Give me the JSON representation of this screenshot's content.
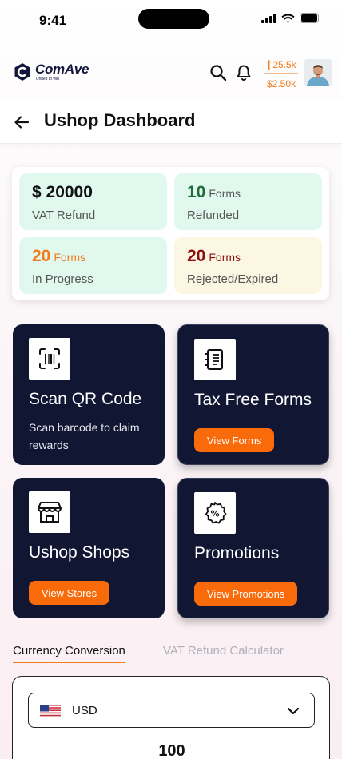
{
  "status_bar": {
    "time": "9:41"
  },
  "header": {
    "brand_name": "ComAve",
    "brand_tagline": "United to win",
    "wallet_points": "25.5k",
    "wallet_money": "$2.50k",
    "icons": [
      "search-icon",
      "bell-icon",
      "coin-icon"
    ]
  },
  "page": {
    "title": "Ushop Dashboard"
  },
  "stats": [
    {
      "value": "$ 20000",
      "unit": "",
      "label": "VAT Refund"
    },
    {
      "value": "10",
      "unit": "Forms",
      "label": "Refunded"
    },
    {
      "value": "20",
      "unit": "Forms",
      "label": "In Progress"
    },
    {
      "value": "20",
      "unit": "Forms",
      "label": "Rejected/Expired"
    }
  ],
  "actions": [
    {
      "title": "Scan QR Code",
      "description": "Scan barcode to claim rewards",
      "icon": "qr-scan-icon"
    },
    {
      "title": "Tax Free Forms",
      "button": "View Forms",
      "icon": "notebook-icon"
    },
    {
      "title": "Ushop Shops",
      "button": "View Stores",
      "icon": "store-icon"
    },
    {
      "title": "Promotions",
      "button": "View Promotions",
      "icon": "percent-badge-icon"
    }
  ],
  "tabs": {
    "active": "Currency Conversion",
    "inactive": "VAT Refund Calculator"
  },
  "conversion": {
    "currency": "USD",
    "amount": "100",
    "flag": "us-flag-icon"
  },
  "colors": {
    "accent": "#f96a0b",
    "card_bg": "#111633",
    "stat_green_bg": "#e0f8ee",
    "stat_yellow_bg": "#fcf7e3",
    "refunded_green": "#1d6a3a",
    "rejected_red": "#8a1010"
  }
}
